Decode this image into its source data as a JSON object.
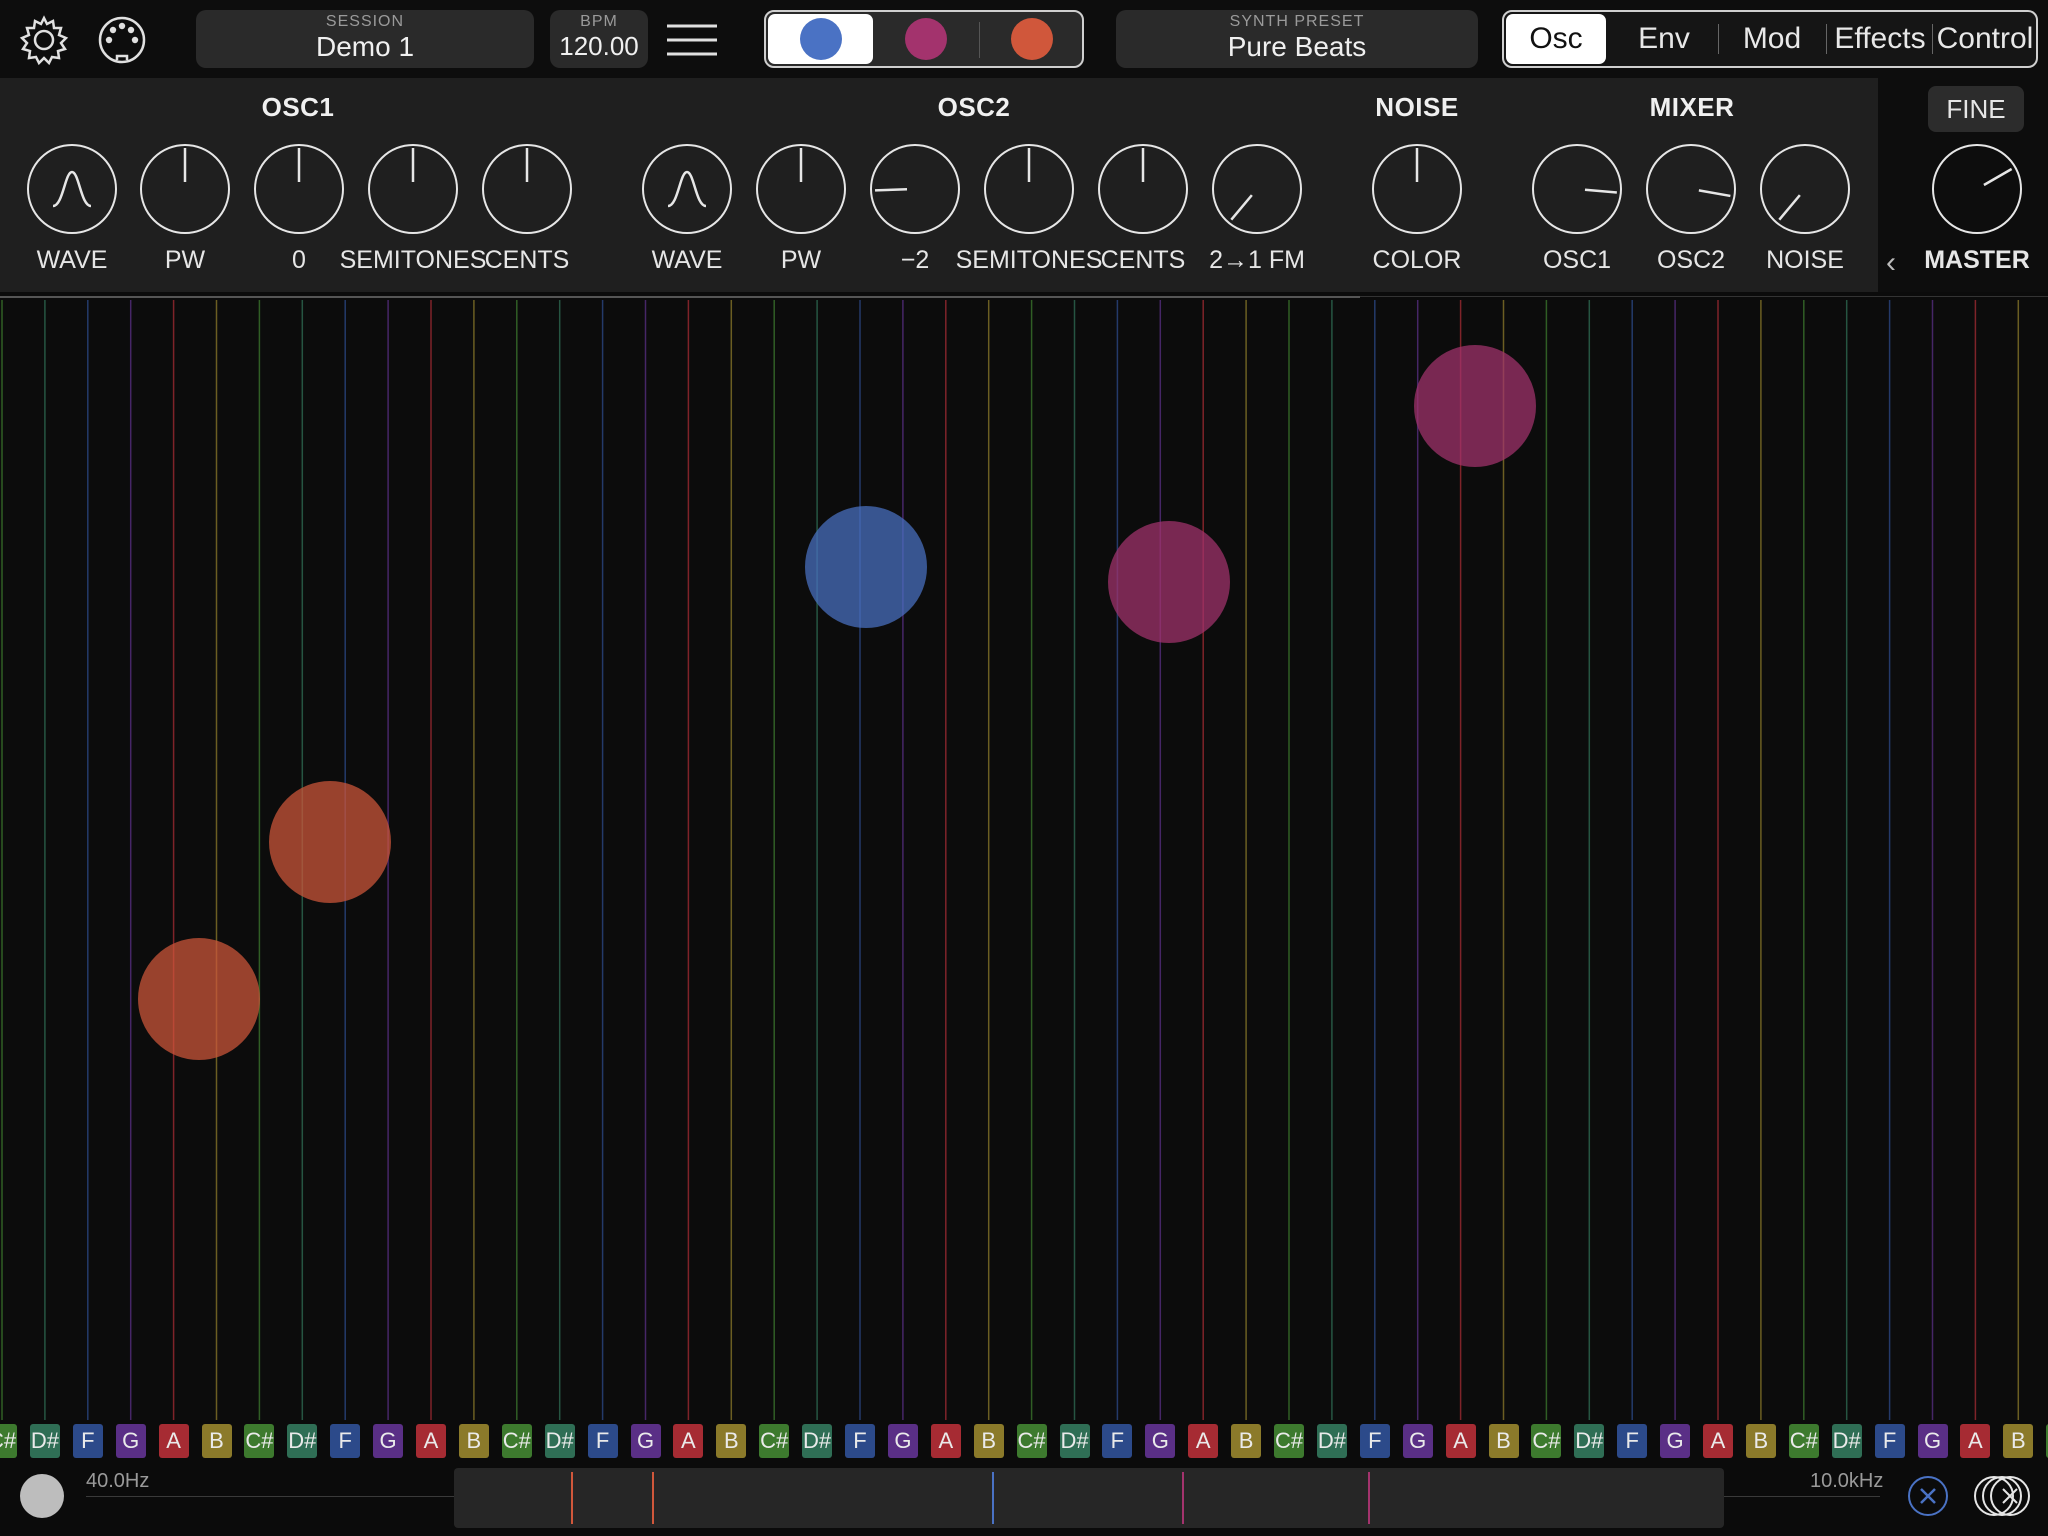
{
  "header": {
    "session": {
      "caption": "SESSION",
      "value": "Demo 1"
    },
    "bpm": {
      "caption": "BPM",
      "value": "120.00"
    },
    "preset": {
      "caption": "SYNTH PRESET",
      "value": "Pure Beats"
    },
    "color_modes": [
      {
        "color": "#4a72c4",
        "active": true
      },
      {
        "color": "#a3336d",
        "active": false
      },
      {
        "color": "#d0573b",
        "active": false
      }
    ],
    "tabs": [
      "Osc",
      "Env",
      "Mod",
      "Effects",
      "Control"
    ],
    "active_tab": "Osc"
  },
  "panel": {
    "sections": {
      "osc1": "OSC1",
      "osc2": "OSC2",
      "noise": "NOISE",
      "mixer": "MIXER"
    },
    "knobs": [
      {
        "label": "WAVE",
        "type": "wave"
      },
      {
        "label": "PW",
        "angle": 0
      },
      {
        "label": "0",
        "angle": 0
      },
      {
        "label": "SEMITONES",
        "angle": 0
      },
      {
        "label": "CENTS",
        "angle": 0
      },
      {
        "label": "WAVE",
        "type": "wave"
      },
      {
        "label": "PW",
        "angle": 0
      },
      {
        "label": "−2",
        "angle": -92
      },
      {
        "label": "SEMITONES",
        "angle": 0
      },
      {
        "label": "CENTS",
        "angle": 0
      },
      {
        "label": "2→1 FM",
        "angle": -140
      },
      {
        "label": "COLOR",
        "angle": 0
      },
      {
        "label": "OSC1",
        "angle": 95
      },
      {
        "label": "OSC2",
        "angle": 100
      },
      {
        "label": "NOISE",
        "angle": -140
      },
      {
        "label": "MASTER",
        "angle": 60
      }
    ],
    "fine_label": "FINE",
    "collapse_glyph": "‹"
  },
  "field": {
    "touches": [
      {
        "color": "#4a72c4",
        "note_x": 0.423,
        "level_y": 0.238
      },
      {
        "color": "#a3336d",
        "note_x": 0.571,
        "level_y": 0.252
      },
      {
        "color": "#a3336d",
        "note_x": 0.72,
        "level_y": 0.095
      },
      {
        "color": "#d0573b",
        "note_x": 0.161,
        "level_y": 0.484
      },
      {
        "color": "#d0573b",
        "note_x": 0.097,
        "level_y": 0.624
      }
    ]
  },
  "notes": {
    "sequence": [
      "C#",
      "D#",
      "F",
      "G",
      "A",
      "B"
    ],
    "colors": {
      "C#": "#3d7a2e",
      "D#": "#2f6e55",
      "F": "#2c4a8a",
      "G": "#5a2f86",
      "A": "#a62b33",
      "B": "#8b7a2a"
    }
  },
  "footer": {
    "freq_min": "40.0Hz",
    "freq_max": "10.0kHz",
    "markers": [
      {
        "color": "#d0573b",
        "pos": 0.092
      },
      {
        "color": "#d0573b",
        "pos": 0.156
      },
      {
        "color": "#4a72c4",
        "pos": 0.424
      },
      {
        "color": "#a3336d",
        "pos": 0.573
      },
      {
        "color": "#a3336d",
        "pos": 0.72
      }
    ]
  }
}
